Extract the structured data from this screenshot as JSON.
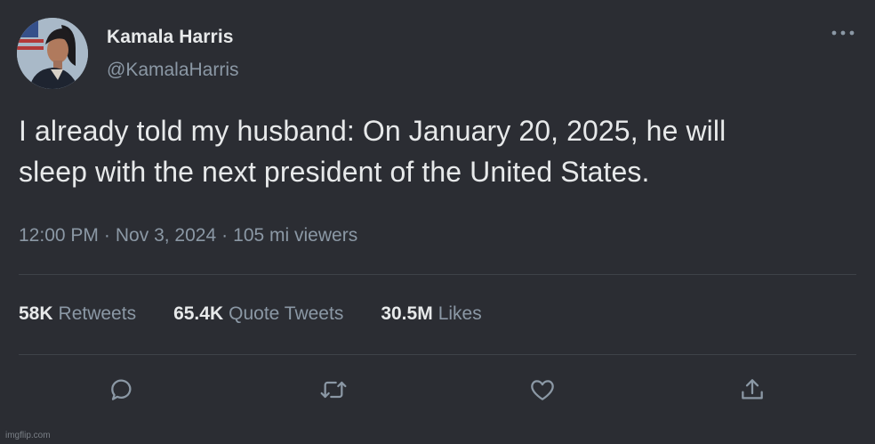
{
  "author": {
    "display_name": "Kamala Harris",
    "handle": "@KamalaHarris"
  },
  "tweet": {
    "line1": "I already told my husband: On January 20, 2025, he will",
    "line2": "sleep with the next president of the United States."
  },
  "meta": {
    "time": "12:00 PM",
    "date": "Nov 3, 2024",
    "views": "105 mi viewers",
    "separator": "·"
  },
  "stats": {
    "retweets_count": "58K",
    "retweets_label": "Retweets",
    "quotes_count": "65.4K",
    "quotes_label": "Quote Tweets",
    "likes_count": "30.5M",
    "likes_label": "Likes"
  },
  "icons": {
    "more": "more-icon",
    "reply": "reply-icon",
    "retweet": "retweet-icon",
    "like": "like-icon",
    "share": "share-icon"
  },
  "watermark": "imgflip.com",
  "colors": {
    "background": "#2b2d33",
    "text_primary": "#e7e9ea",
    "text_secondary": "#8b98a5",
    "divider": "#3e4248"
  }
}
